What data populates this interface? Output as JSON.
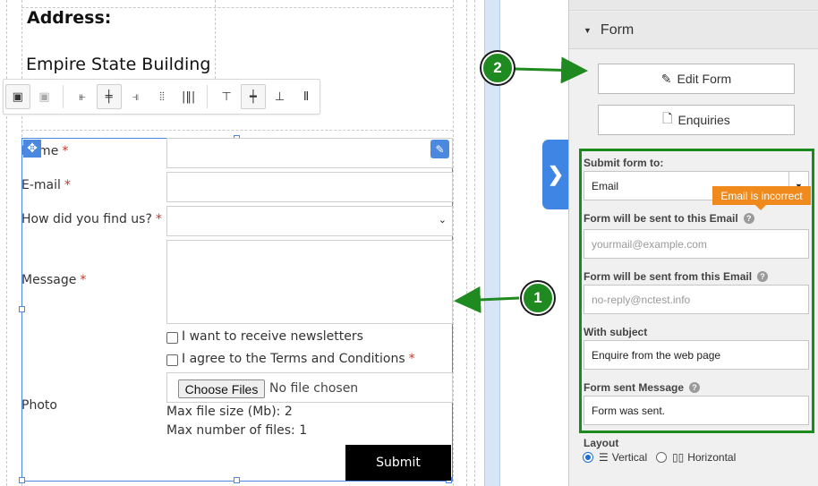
{
  "canvas": {
    "address_title": "Address:",
    "address_value": "Empire State Building"
  },
  "toolbar": {
    "buttons": [
      "select-block-icon",
      "deselect-block-icon",
      "align-left-icon",
      "align-center-icon",
      "align-right-icon",
      "distribute-horizontal-icon",
      "distribute-spaced-icon",
      "align-top-icon",
      "align-middle-icon",
      "align-bottom-icon",
      "stretch-vertical-icon"
    ]
  },
  "web_form": {
    "fields": {
      "name_label": "Name",
      "email_label": "E-mail",
      "find_label": "How did you find us?",
      "message_label": "Message",
      "photo_label": "Photo",
      "required_mark": "*"
    },
    "newsletter_label": "I want to receive newsletters",
    "terms_label": "I agree to the Terms and Conditions",
    "choose_files_label": "Choose Files",
    "no_file_text": "No file chosen",
    "max_size_text": "Max file size (Mb): 2",
    "max_files_text": "Max number of files: 1",
    "submit_label": "Submit"
  },
  "callouts": {
    "one": "1",
    "two": "2"
  },
  "panel": {
    "header": "Form",
    "edit_form_label": "Edit Form",
    "enquiries_label": "Enquiries",
    "submit_to_label": "Submit form to:",
    "submit_to_value": "Email",
    "error_tip": "Email is incorrect",
    "sent_to_label": "Form will be sent to this Email",
    "sent_to_placeholder": "yourmail@example.com",
    "sent_from_label": "Form will be sent from this Email",
    "sent_from_placeholder": "no-reply@nctest.info",
    "subject_label": "With subject",
    "subject_value": "Enquire from the web page",
    "message_label": "Form sent Message",
    "message_value": "Form was sent.",
    "layout_label": "Layout",
    "layout_vertical": "Vertical",
    "layout_horizontal": "Horizontal",
    "layout_selected": "Vertical"
  },
  "colors": {
    "selection_blue": "#4b88e0",
    "callout_green": "#1f8a1f",
    "error_orange": "#f08a1c",
    "strip_blue": "#d8e5f9"
  }
}
